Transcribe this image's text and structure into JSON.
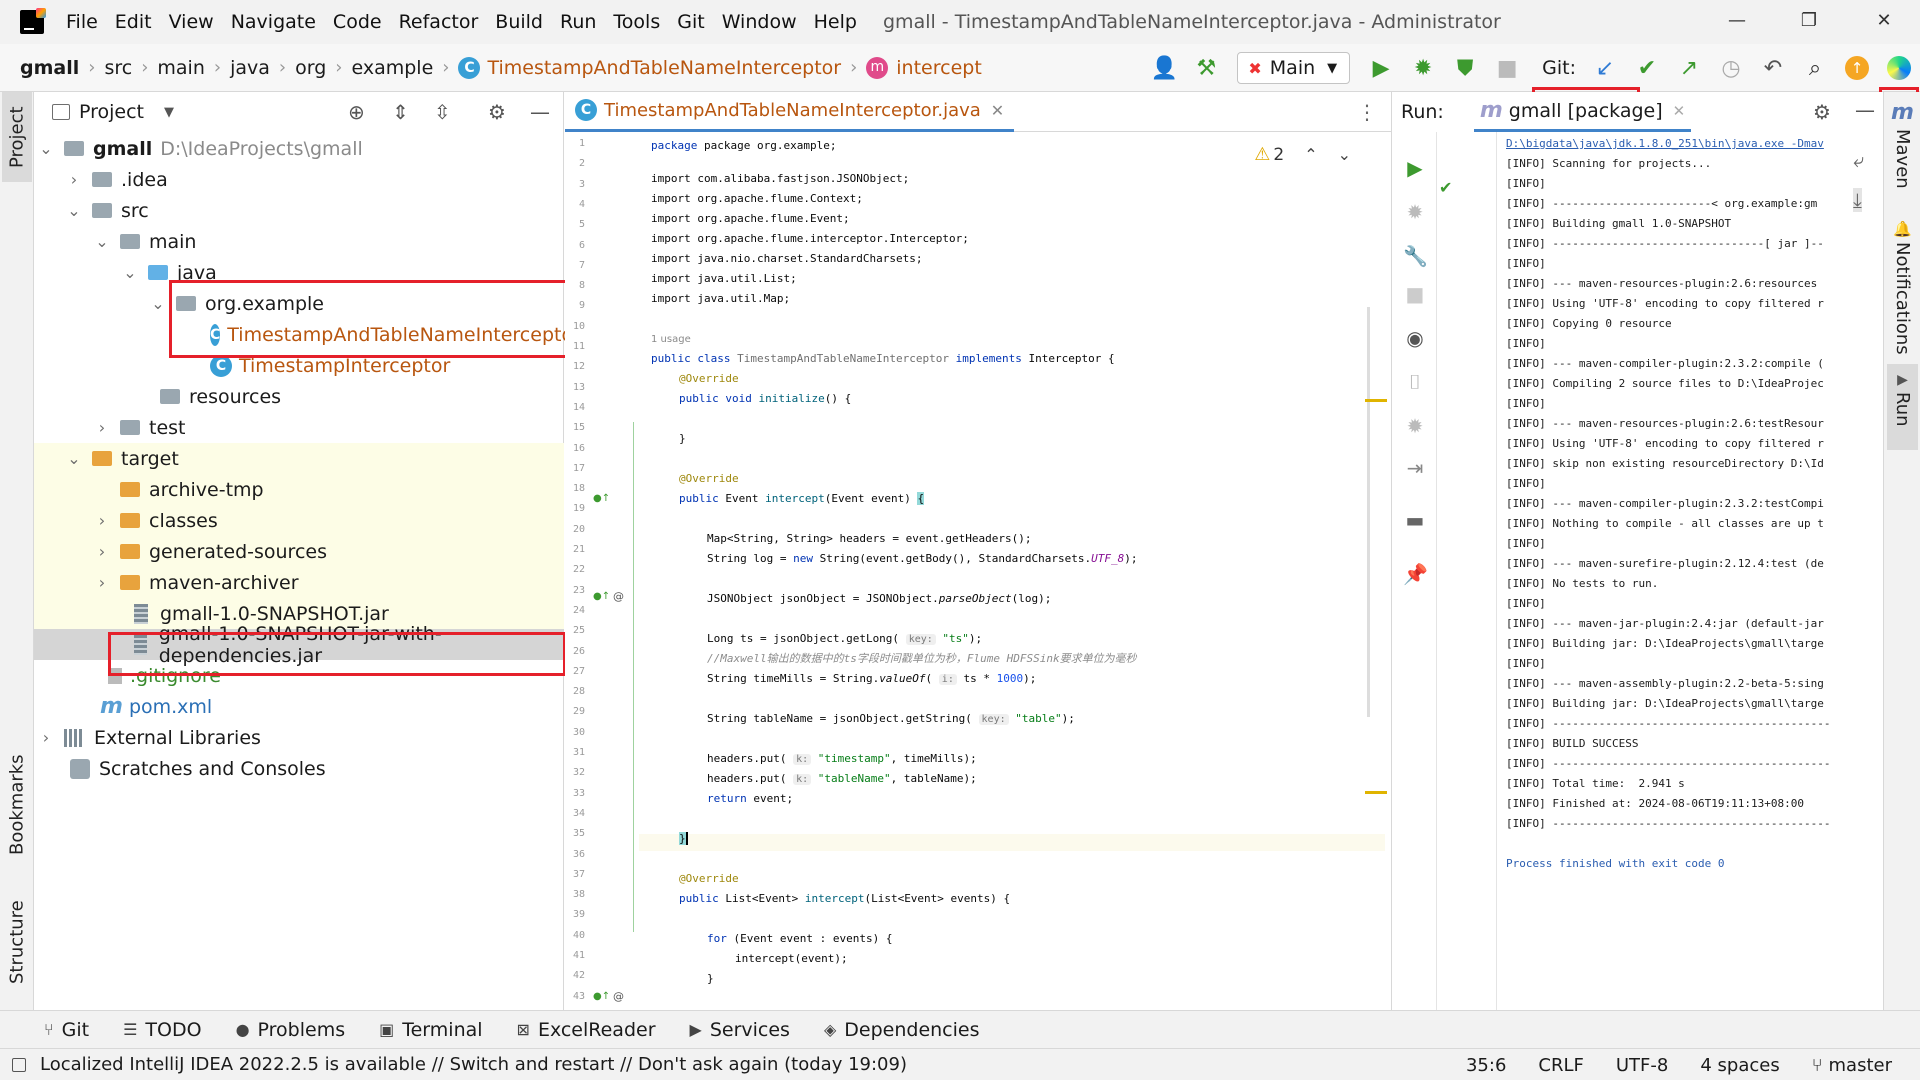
{
  "window": {
    "title": "gmall - TimestampAndTableNameInterceptor.java - Administrator",
    "menu": [
      "File",
      "Edit",
      "View",
      "Navigate",
      "Code",
      "Refactor",
      "Build",
      "Run",
      "Tools",
      "Git",
      "Window",
      "Help"
    ],
    "controls": [
      "—",
      "❐",
      "✕"
    ]
  },
  "navbar": {
    "breadcrumbs": [
      "gmall",
      "src",
      "main",
      "java",
      "org",
      "example",
      "TimestampAndTableNameInterceptor",
      "intercept"
    ],
    "run_config": "Main",
    "git_label": "Git:"
  },
  "left_strip": {
    "tabs": [
      "Project",
      "Bookmarks",
      "Structure"
    ]
  },
  "project": {
    "title": "Project",
    "tree": [
      {
        "label": "gmall",
        "sub": "D:\\IdeaProjects\\gmall"
      },
      {
        "label": ".idea"
      },
      {
        "label": "src"
      },
      {
        "label": "main"
      },
      {
        "label": "java"
      },
      {
        "label": "org.example"
      },
      {
        "label": "TimestampAndTableNameInterceptor"
      },
      {
        "label": "TimestampInterceptor"
      },
      {
        "label": "resources"
      },
      {
        "label": "test"
      },
      {
        "label": "target"
      },
      {
        "label": "archive-tmp"
      },
      {
        "label": "classes"
      },
      {
        "label": "generated-sources"
      },
      {
        "label": "maven-archiver"
      },
      {
        "label": "gmall-1.0-SNAPSHOT.jar"
      },
      {
        "label": "gmall-1.0-SNAPSHOT-jar-with-dependencies.jar"
      },
      {
        "label": ".gitignore"
      },
      {
        "label": "pom.xml"
      },
      {
        "label": "External Libraries"
      },
      {
        "label": "Scratches and Consoles"
      }
    ]
  },
  "editor": {
    "tab_label": "TimestampAndTableNameInterceptor.java",
    "warnings_count": "2",
    "usage_hint": "1 usage",
    "line_numbers": [
      "1",
      "2",
      "3",
      "4",
      "5",
      "6",
      "7",
      "8",
      "9",
      "10",
      "11",
      "12",
      "13",
      "14",
      "15",
      "16",
      "17",
      "18",
      "19",
      "20",
      "21",
      "22",
      "23",
      "24",
      "25",
      "26",
      "27",
      "28",
      "29",
      "30",
      "31",
      "32",
      "33",
      "34",
      "35",
      "36",
      "37",
      "38",
      "39",
      "40",
      "41",
      "42",
      "43"
    ],
    "code": {
      "l1": "package org.example;",
      "l3": "import com.alibaba.fastjson.JSONObject;",
      "l4": "import org.apache.flume.Context;",
      "l5": "import org.apache.flume.Event;",
      "l6": "import org.apache.flume.interceptor.Interceptor;",
      "l7": "import java.nio.charset.StandardCharsets;",
      "l8": "import java.util.List;",
      "l9": "import java.util.Map;",
      "l11a": "public class ",
      "l11b": "TimestampAndTableNameInterceptor",
      "l11c": " implements ",
      "l11d": "Interceptor {",
      "override": "@Override",
      "l13a": "public void ",
      "l13b": "initialize",
      "l13c": "() {",
      "l15": "}",
      "l18a": "public ",
      "l18b": "Event ",
      "l18c": "intercept",
      "l18d": "(Event event) ",
      "l20": "Map<String, String> headers = event.getHeaders();",
      "l21a": "String log = ",
      "l21b": "new ",
      "l21c": "String(event.getBody(), StandardCharsets.",
      "l21d": "UTF_8",
      "l21e": ");",
      "l23a": "JSONObject jsonObject = JSONObject.",
      "l23b": "parseObject",
      "l23c": "(log);",
      "l25a": "Long ts = jsonObject.getLong( ",
      "l25hint": "key:",
      "l25b": " \"ts\"",
      "l25c": ");",
      "l26": "//Maxwell输出的数据中的ts字段时间戳单位为秒，Flume HDFSSink要求单位为毫秒",
      "l27a": "String timeMills = String.",
      "l27b": "valueOf",
      "l27c": "( ",
      "l27hint": "i:",
      "l27d": " ts * ",
      "l27e": "1000",
      "l27f": ");",
      "l29a": "String tableName = jsonObject.getString( ",
      "l29hint": "key:",
      "l29b": " \"table\"",
      "l29c": ");",
      "l31a": "headers.put( ",
      "l31hint": "k:",
      "l31b": " \"timestamp\"",
      "l31c": ", timeMills);",
      "l32a": "headers.put( ",
      "l32hint": "k:",
      "l32b": " \"tableName\"",
      "l32c": ", tableName);",
      "l33a": "return ",
      "l33b": "event;",
      "l35": "}",
      "l38a": "public ",
      "l38b": "List<Event> ",
      "l38c": "intercept",
      "l38d": "(List<Event> events) {",
      "l40a": "for ",
      "l40b": "(Event event : events) {",
      "l41": "intercept(event);",
      "l42": "}"
    }
  },
  "run": {
    "label": "Run:",
    "tab_label": "gmall [package]",
    "console": [
      "D:\\bigdata\\java\\jdk.1.8.0_251\\bin\\java.exe -Dmav",
      "[INFO] Scanning for projects...",
      "[INFO]",
      "[INFO] ------------------------< org.example:gm",
      "[INFO] Building gmall 1.0-SNAPSHOT",
      "[INFO] --------------------------------[ jar ]--",
      "[INFO]",
      "[INFO] --- maven-resources-plugin:2.6:resources",
      "[INFO] Using 'UTF-8' encoding to copy filtered r",
      "[INFO] Copying 0 resource",
      "[INFO]",
      "[INFO] --- maven-compiler-plugin:2.3.2:compile (",
      "[INFO] Compiling 2 source files to D:\\IdeaProjec",
      "[INFO]",
      "[INFO] --- maven-resources-plugin:2.6:testResour",
      "[INFO] Using 'UTF-8' encoding to copy filtered r",
      "[INFO] skip non existing resourceDirectory D:\\Id",
      "[INFO]",
      "[INFO] --- maven-compiler-plugin:2.3.2:testCompi",
      "[INFO] Nothing to compile - all classes are up t",
      "[INFO]",
      "[INFO] --- maven-surefire-plugin:2.12.4:test (de",
      "[INFO] No tests to run.",
      "[INFO]",
      "[INFO] --- maven-jar-plugin:2.4:jar (default-jar",
      "[INFO] Building jar: D:\\IdeaProjects\\gmall\\targe",
      "[INFO]",
      "[INFO] --- maven-assembly-plugin:2.2-beta-5:sing",
      "[INFO] Building jar: D:\\IdeaProjects\\gmall\\targe",
      "[INFO] ------------------------------------------",
      "[INFO] BUILD SUCCESS",
      "[INFO] ------------------------------------------",
      "[INFO] Total time:  2.941 s",
      "[INFO] Finished at: 2024-08-06T19:11:13+08:00",
      "[INFO] ------------------------------------------",
      "",
      "Process finished with exit code 0"
    ]
  },
  "right_strip": {
    "tabs": [
      "Maven",
      "Notifications",
      "Run"
    ]
  },
  "bottom_bar": {
    "items": [
      "Git",
      "TODO",
      "Problems",
      "Terminal",
      "ExcelReader",
      "Services",
      "Dependencies"
    ]
  },
  "status": {
    "message": "Localized IntelliJ IDEA 2022.2.5 is available // Switch and restart // Don't ask again (today 19:09)",
    "position": "35:6",
    "line_sep": "CRLF",
    "encoding": "UTF-8",
    "indent": "4 spaces",
    "branch": "master"
  }
}
